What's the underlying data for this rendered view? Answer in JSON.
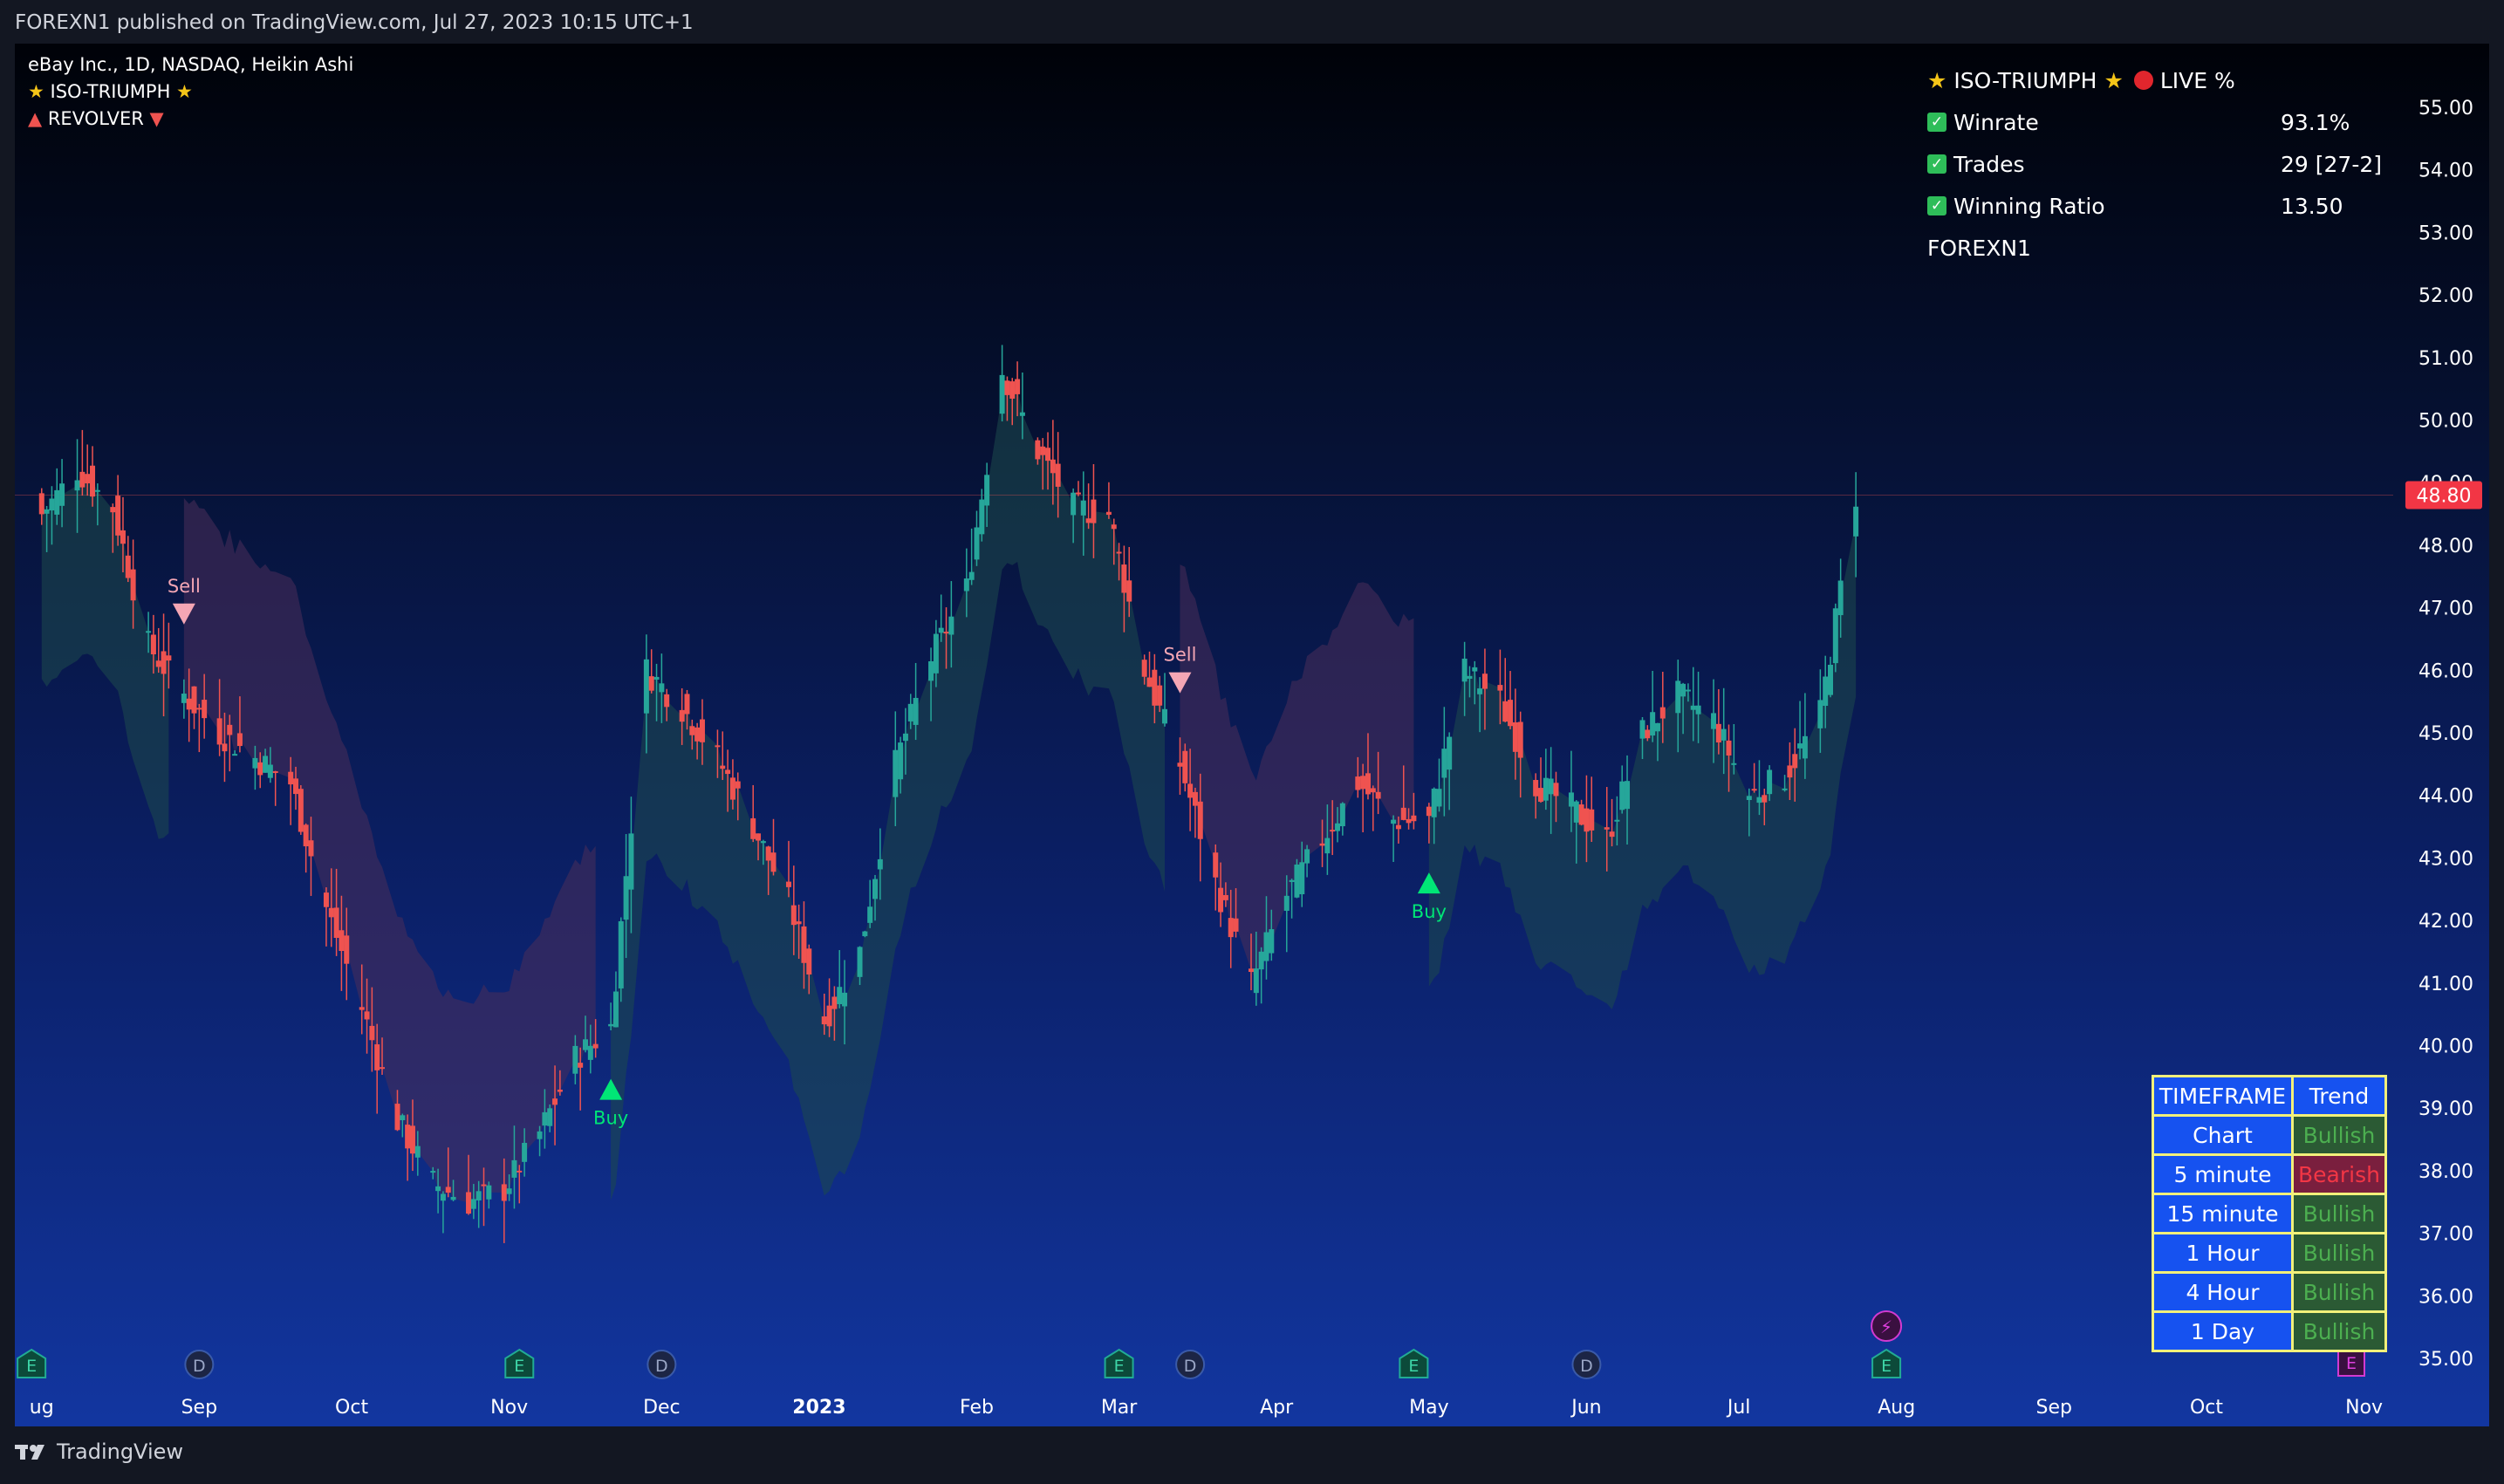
{
  "header": {
    "published": "FOREXN1 published on TradingView.com, Jul 27, 2023 10:15 UTC+1"
  },
  "legend": {
    "symbol": "eBay Inc., 1D, NASDAQ, Heikin Ashi",
    "indicator1": "ISO-TRIUMPH",
    "indicator2": "REVOLVER"
  },
  "stats": {
    "title": "ISO-TRIUMPH",
    "live": "LIVE %",
    "rows": [
      {
        "label": "Winrate",
        "value": "93.1%"
      },
      {
        "label": "Trades",
        "value": "29 [27-2]"
      },
      {
        "label": "Winning Ratio",
        "value": "13.50"
      }
    ],
    "author": "FOREXN1"
  },
  "trend_table": {
    "header_timeframe": "TIMEFRAME",
    "header_trend": "Trend",
    "rows": [
      {
        "timeframe": "Chart",
        "trend": "Bullish"
      },
      {
        "timeframe": "5 minute",
        "trend": "Bearish"
      },
      {
        "timeframe": "15 minute",
        "trend": "Bullish"
      },
      {
        "timeframe": "1 Hour",
        "trend": "Bullish"
      },
      {
        "timeframe": "4 Hour",
        "trend": "Bullish"
      },
      {
        "timeframe": "1 Day",
        "trend": "Bullish"
      }
    ]
  },
  "colors": {
    "bull": "#26a69a",
    "bear": "#ef5350",
    "buy_signal": "#00e676",
    "sell_signal": "#f4a6b4",
    "bull_band": "#1e4b4c",
    "bear_band": "#4a2d5a",
    "price_label": "#f23645",
    "bullish_text": "#4caf50",
    "bearish_text": "#f23645",
    "bullish_cell": "#2b5a34",
    "bearish_cell": "#7a1f3e"
  },
  "chart_data": {
    "type": "candlestick",
    "style": "Heikin Ashi",
    "title": "eBay Inc., 1D, NASDAQ, Heikin Ashi",
    "x_ticks": [
      "ug",
      "Sep",
      "Oct",
      "Nov",
      "Dec",
      "2023",
      "Feb",
      "Mar",
      "Apr",
      "May",
      "Jun",
      "Jul",
      "Aug",
      "Sep",
      "Oct",
      "Nov"
    ],
    "y_ticks": [
      "55.00",
      "54.00",
      "53.00",
      "52.00",
      "51.00",
      "50.00",
      "49.00",
      "48.00",
      "47.00",
      "46.00",
      "45.00",
      "44.00",
      "43.00",
      "42.00",
      "41.00",
      "40.00",
      "39.00",
      "38.00",
      "37.00",
      "36.00",
      "35.00"
    ],
    "ylim": [
      34.4,
      55.6
    ],
    "last_price": "48.80",
    "price_path": [
      [
        "2022-08-01",
        48.5
      ],
      [
        "2022-08-08",
        49.2
      ],
      [
        "2022-08-15",
        48.6
      ],
      [
        "2022-08-22",
        46.4
      ],
      [
        "2022-08-29",
        45.6
      ],
      [
        "2022-09-05",
        45.0
      ],
      [
        "2022-09-12",
        44.6
      ],
      [
        "2022-09-19",
        44.2
      ],
      [
        "2022-09-26",
        42.2
      ],
      [
        "2022-10-03",
        40.6
      ],
      [
        "2022-10-10",
        38.8
      ],
      [
        "2022-10-17",
        37.8
      ],
      [
        "2022-10-24",
        37.5
      ],
      [
        "2022-10-31",
        37.7
      ],
      [
        "2022-11-07",
        38.6
      ],
      [
        "2022-11-14",
        39.8
      ],
      [
        "2022-11-21",
        40.3
      ],
      [
        "2022-11-28",
        46.0
      ],
      [
        "2022-12-05",
        45.4
      ],
      [
        "2022-12-12",
        44.6
      ],
      [
        "2022-12-19",
        43.5
      ],
      [
        "2022-12-26",
        42.3
      ],
      [
        "2023-01-02",
        40.4
      ],
      [
        "2023-01-09",
        41.5
      ],
      [
        "2023-01-16",
        44.5
      ],
      [
        "2023-01-23",
        46.2
      ],
      [
        "2023-01-30",
        47.3
      ],
      [
        "2023-02-06",
        50.8
      ],
      [
        "2023-02-13",
        49.5
      ],
      [
        "2023-02-20",
        48.6
      ],
      [
        "2023-02-27",
        48.5
      ],
      [
        "2023-03-06",
        46.0
      ],
      [
        "2023-03-13",
        44.5
      ],
      [
        "2023-03-20",
        42.6
      ],
      [
        "2023-03-27",
        41.0
      ],
      [
        "2023-04-03",
        42.4
      ],
      [
        "2023-04-10",
        43.3
      ],
      [
        "2023-04-17",
        44.2
      ],
      [
        "2023-04-24",
        43.6
      ],
      [
        "2023-05-01",
        43.6
      ],
      [
        "2023-05-08",
        46.0
      ],
      [
        "2023-05-15",
        45.5
      ],
      [
        "2023-05-22",
        44.2
      ],
      [
        "2023-05-29",
        43.8
      ],
      [
        "2023-06-05",
        43.3
      ],
      [
        "2023-06-12",
        45.0
      ],
      [
        "2023-06-19",
        45.6
      ],
      [
        "2023-06-26",
        45.2
      ],
      [
        "2023-07-03",
        44.0
      ],
      [
        "2023-07-10",
        44.3
      ],
      [
        "2023-07-17",
        45.3
      ],
      [
        "2023-07-24",
        48.8
      ]
    ],
    "signals": [
      {
        "type": "Sell",
        "date": "2022-08-29"
      },
      {
        "type": "Buy",
        "date": "2022-11-21"
      },
      {
        "type": "Sell",
        "date": "2023-03-13"
      },
      {
        "type": "Buy",
        "date": "2023-05-01"
      }
    ]
  }
}
